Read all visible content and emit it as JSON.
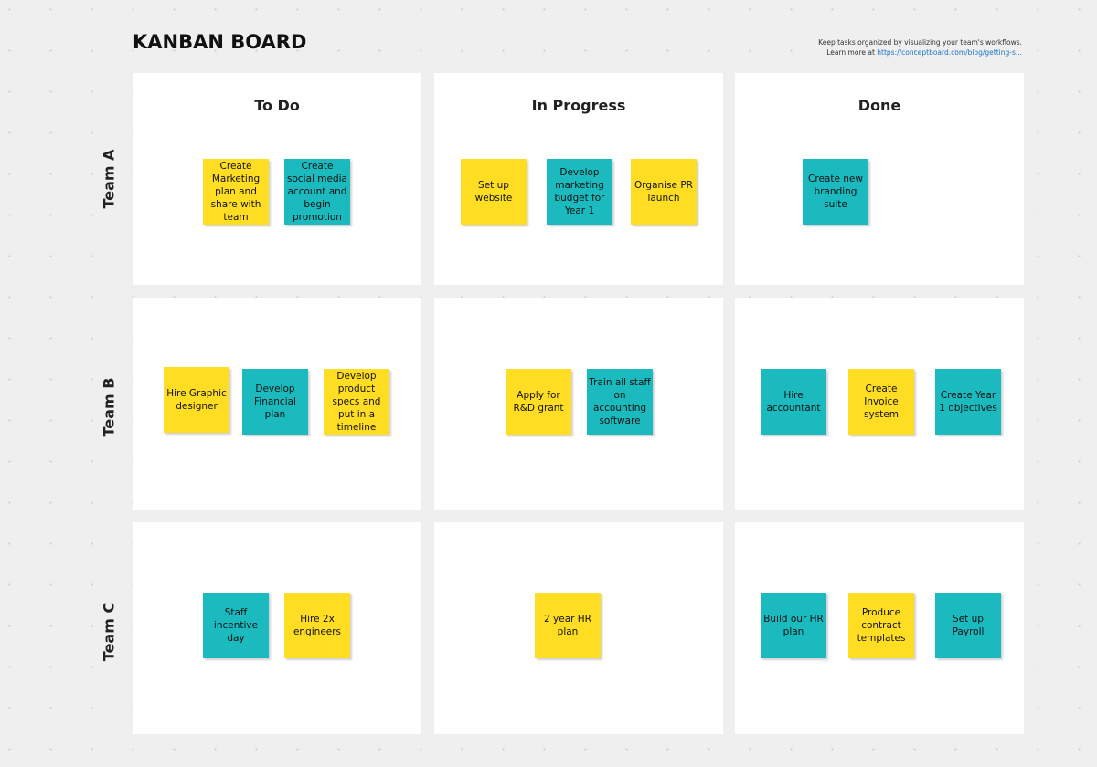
{
  "board": {
    "title": "KANBAN BOARD",
    "info_line1": "Keep tasks organized by visualizing your team's workflows.",
    "info_prefix": "Learn more at ",
    "info_link": "https://conceptboard.com/blog/getting-s..."
  },
  "colors": {
    "yellow": "#ffdd22",
    "teal": "#1ababe"
  },
  "columns": [
    "To Do",
    "In Progress",
    "Done"
  ],
  "rows": [
    "Team A",
    "Team B",
    "Team C"
  ],
  "notes": {
    "a_todo": [
      {
        "text": "Create Marketing plan and share with team",
        "color": "yellow"
      },
      {
        "text": "Create social media account and begin promotion",
        "color": "teal"
      }
    ],
    "a_progress": [
      {
        "text": "Set up website",
        "color": "yellow"
      },
      {
        "text": "Develop marketing budget for Year 1",
        "color": "teal"
      },
      {
        "text": "Organise PR launch",
        "color": "yellow"
      }
    ],
    "a_done": [
      {
        "text": "Create new branding suite",
        "color": "teal"
      }
    ],
    "b_todo": [
      {
        "text": "Hire Graphic designer",
        "color": "yellow"
      },
      {
        "text": "Develop Financial plan",
        "color": "teal"
      },
      {
        "text": "Develop product specs and put in a timeline",
        "color": "yellow"
      }
    ],
    "b_progress": [
      {
        "text": "Apply for R&D grant",
        "color": "yellow"
      },
      {
        "text": "Train all staff on accounting software",
        "color": "teal"
      }
    ],
    "b_done": [
      {
        "text": "Hire accountant",
        "color": "teal"
      },
      {
        "text": "Create Invoice system",
        "color": "yellow"
      },
      {
        "text": "Create Year 1 objectives",
        "color": "teal"
      }
    ],
    "c_todo": [
      {
        "text": "Staff incentive day",
        "color": "teal"
      },
      {
        "text": "Hire 2x engineers",
        "color": "yellow"
      }
    ],
    "c_progress": [
      {
        "text": "2 year HR plan",
        "color": "yellow"
      }
    ],
    "c_done": [
      {
        "text": "Build our HR plan",
        "color": "teal"
      },
      {
        "text": "Produce contract templates",
        "color": "yellow"
      },
      {
        "text": "Set up Payroll",
        "color": "teal"
      }
    ]
  }
}
